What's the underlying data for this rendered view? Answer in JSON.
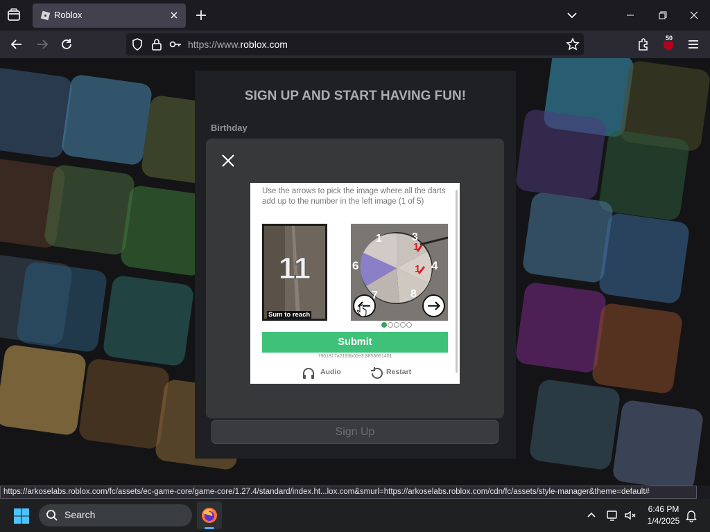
{
  "browser": {
    "tab_title": "Roblox",
    "url_prefix": "https://www.",
    "url_domain": "roblox.com",
    "extension_badge": "50",
    "status_url": "https://arkoselabs.roblox.com/fc/assets/ec-game-core/game-core/1.27.4/standard/index.ht...lox.com&smurl=https://arkoselabs.roblox.com/cdn/fc/assets/style-manager&theme=default#"
  },
  "page": {
    "title": "SIGN UP AND START HAVING FUN!",
    "birthday_label": "Birthday",
    "signup_button": "Sign Up"
  },
  "captcha": {
    "instruction": "Use the arrows to pick the image where all the darts add up to the number in the left image (1 of 5)",
    "target_number": "11",
    "target_caption": "Sum to reach",
    "wheel_numbers": [
      "1",
      "3",
      "6",
      "4",
      "7",
      "8"
    ],
    "dart_values": [
      "1",
      "1"
    ],
    "current_image": 1,
    "total_images": 5,
    "submit_label": "Submit",
    "session_id": "7961817a2193b01e3.8853661401",
    "audio_label": "Audio",
    "restart_label": "Restart"
  },
  "taskbar": {
    "search_label": "Search",
    "time": "6:46 PM",
    "date": "1/4/2025"
  },
  "colors": {
    "submit_green": "#40c17a",
    "active_dot": "#3da160",
    "tab_active": "#42414d",
    "chrome_dark": "#1c1b22",
    "wheel_purple": "#8b7fc7"
  },
  "icons": {
    "tab_list": "tab-list-icon",
    "favicon": "roblox-favicon-icon",
    "back": "back-arrow-icon",
    "forward": "forward-arrow-icon",
    "reload": "reload-icon",
    "shield": "tracking-shield-icon",
    "lock": "lock-icon",
    "key": "key-icon",
    "bookmark": "star-icon",
    "extensions": "extensions-puzzle-icon",
    "menu": "hamburger-menu-icon",
    "audio": "headphones-icon",
    "restart": "restart-icon",
    "start": "windows-logo-icon"
  }
}
